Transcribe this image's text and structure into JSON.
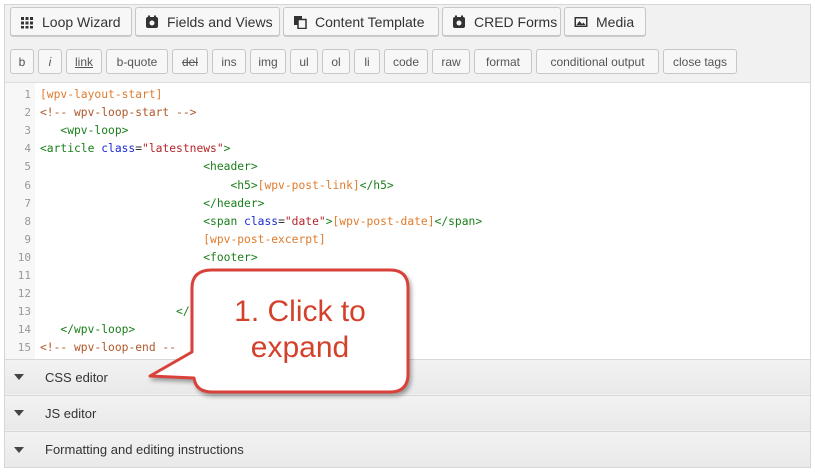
{
  "toolbar": {
    "buttons": [
      {
        "label": "Loop Wizard",
        "icon": "grid-icon"
      },
      {
        "label": "Fields and Views",
        "icon": "toolset-icon"
      },
      {
        "label": "Content Template",
        "icon": "copy-icon"
      },
      {
        "label": "CRED Forms",
        "icon": "toolset-icon"
      },
      {
        "label": "Media",
        "icon": "image-icon"
      }
    ]
  },
  "quicktags": [
    "b",
    "i",
    "link",
    "b-quote",
    "del",
    "ins",
    "img",
    "ul",
    "ol",
    "li",
    "code",
    "raw",
    "format",
    "conditional output",
    "close tags"
  ],
  "code": {
    "line_numbers": [
      "1",
      "2",
      "3",
      "4",
      "5",
      "6",
      "7",
      "8",
      "9",
      "10",
      "11",
      "12",
      "13",
      "14",
      "15"
    ],
    "lines": [
      {
        "indent": "",
        "parts": [
          [
            "sc",
            "[wpv-layout-start]"
          ]
        ]
      },
      {
        "indent": "",
        "parts": [
          [
            "cm",
            "<!-- wpv-loop-start -->"
          ]
        ]
      },
      {
        "indent": "   ",
        "parts": [
          [
            "tag",
            "<wpv-loop>"
          ]
        ]
      },
      {
        "indent": "",
        "parts": [
          [
            "tag",
            "<article "
          ],
          [
            "attr",
            "class"
          ],
          [
            "bk",
            "="
          ],
          [
            "str",
            "\"latestnews\""
          ],
          [
            "tag",
            ">"
          ]
        ]
      },
      {
        "indent": "                        ",
        "parts": [
          [
            "tag",
            "<header>"
          ]
        ]
      },
      {
        "indent": "                            ",
        "parts": [
          [
            "tag",
            "<h5>"
          ],
          [
            "sc",
            "[wpv-post-link]"
          ],
          [
            "tag",
            "</h5>"
          ]
        ]
      },
      {
        "indent": "                        ",
        "parts": [
          [
            "tag",
            "</header>"
          ]
        ]
      },
      {
        "indent": "                        ",
        "parts": [
          [
            "tag",
            "<span "
          ],
          [
            "attr",
            "class"
          ],
          [
            "bk",
            "="
          ],
          [
            "str",
            "\"date\""
          ],
          [
            "tag",
            ">"
          ],
          [
            "sc",
            "[wpv-post-date]"
          ],
          [
            "tag",
            "</span>"
          ]
        ]
      },
      {
        "indent": "                        ",
        "parts": [
          [
            "sc",
            "[wpv-post-excerpt]"
          ]
        ]
      },
      {
        "indent": "                        ",
        "parts": [
          [
            "tag",
            "<footer>"
          ]
        ]
      },
      {
        "indent": "",
        "parts": []
      },
      {
        "indent": "",
        "parts": []
      },
      {
        "indent": "                    ",
        "parts": [
          [
            "tag",
            "</"
          ]
        ]
      },
      {
        "indent": "   ",
        "parts": [
          [
            "tag",
            "</wpv-loop>"
          ]
        ]
      },
      {
        "indent": "",
        "parts": [
          [
            "cm",
            "<!-- wpv-loop-end --"
          ]
        ]
      }
    ]
  },
  "sections": [
    {
      "title": "CSS editor"
    },
    {
      "title": "JS editor"
    },
    {
      "title": "Formatting and editing instructions"
    }
  ],
  "callout": {
    "line1": "1. Click to",
    "line2": "expand",
    "color": "#d9423a"
  }
}
